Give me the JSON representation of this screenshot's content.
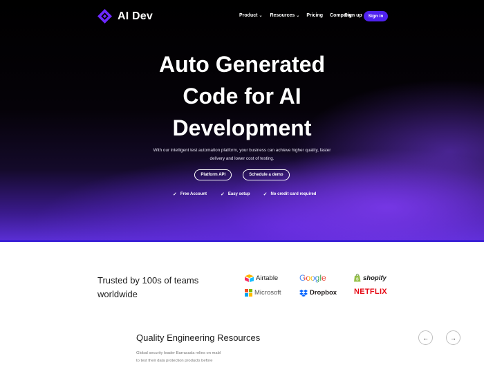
{
  "nav": {
    "brand": "AI Dev",
    "links": [
      {
        "label": "Product",
        "caret": true
      },
      {
        "label": "Resources",
        "caret": true
      },
      {
        "label": "Pricing",
        "caret": false
      },
      {
        "label": "Company",
        "caret": false
      }
    ],
    "signup_label": "Sign up",
    "signin_label": "Sign in"
  },
  "hero": {
    "headline_lines": [
      "Auto Generated",
      "Code for AI",
      "Development"
    ],
    "subtext_lines": [
      "With our intelligent test automation platform, your business can achieve higher quality, faster",
      "delivery and lower cost of testing."
    ],
    "buttons": [
      "Platform API",
      "Schedule a demo"
    ],
    "checks": [
      "Free Account",
      "Easy setup",
      "No credit card required"
    ]
  },
  "trusted": {
    "heading_lines": [
      "Trusted by 100s of teams",
      "worldwide"
    ],
    "brands": [
      "Airtable",
      "Google",
      "shopify",
      "Microsoft",
      "Dropbox",
      "NETFLIX"
    ]
  },
  "resources": {
    "title": "Quality Engineering Resources",
    "text_lines": [
      "Global security leader Barracuda relies on mabl",
      "to test their data protection products before"
    ],
    "prev_icon": "arrow-left-icon",
    "next_icon": "arrow-right-icon"
  },
  "colors": {
    "accent": "#4f22ef",
    "google_blue": "#4285f4",
    "google_red": "#ea4335",
    "google_yellow": "#fbbc05",
    "google_green": "#34a853",
    "netflix_red": "#e50914",
    "shopify_green": "#95bf47",
    "dropbox_blue": "#0061ff"
  }
}
